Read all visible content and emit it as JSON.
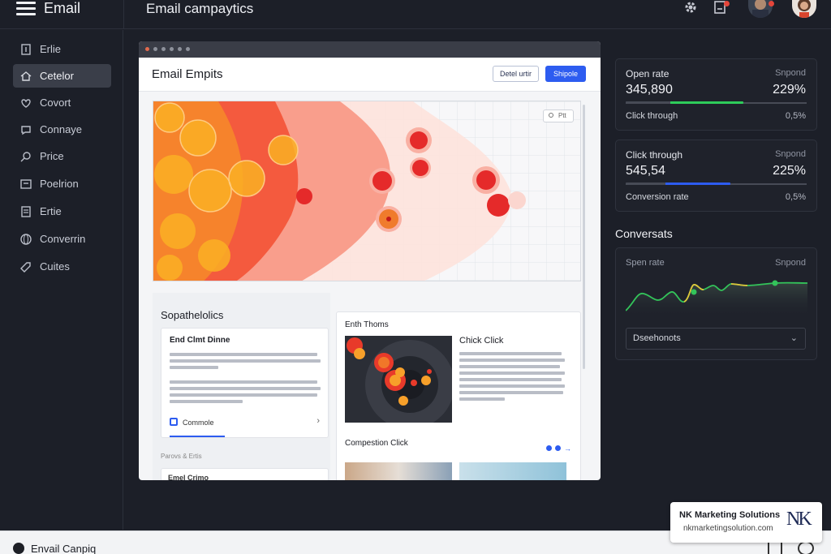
{
  "app": {
    "brand": "Email",
    "page_title": "Email campaytics"
  },
  "sidebar": {
    "items": [
      {
        "label": "Erlie",
        "icon": "file-icon"
      },
      {
        "label": "Cetelor",
        "icon": "home-icon",
        "active": true
      },
      {
        "label": "Covort",
        "icon": "heart-icon"
      },
      {
        "label": "Connaye",
        "icon": "chat-icon"
      },
      {
        "label": "Price",
        "icon": "search-icon"
      },
      {
        "label": "Poelrion",
        "icon": "image-icon"
      },
      {
        "label": "Ertie",
        "icon": "doc-icon"
      },
      {
        "label": "Converrin",
        "icon": "globe-icon"
      },
      {
        "label": "Cuites",
        "icon": "tag-icon"
      }
    ]
  },
  "preview": {
    "title": "Email Empits",
    "btn_secondary": "Detel urtir",
    "btn_primary": "Shipole",
    "heatmap_pill": "Ptt",
    "left_panel": {
      "title": "Sopathelolics",
      "card_title": "End Clmt Dinne",
      "card_button": "Commole",
      "sub_label": "Parovs & Ertis",
      "card2_title": "Emel Crimo"
    },
    "right_panel": {
      "title": "Enth Thoms",
      "heading": "Chick Click",
      "subtitle": "Compestion Click"
    }
  },
  "stats": [
    {
      "label": "Open rate",
      "right": "Snpond",
      "value": "345,890",
      "pct": "229%",
      "foot": "Click through",
      "foot_right": "0,5%",
      "bar_fill": 0.65,
      "bar_color": "#2ecc5a"
    },
    {
      "label": "Click through",
      "right": "Snpond",
      "value": "545,54",
      "pct": "225%",
      "foot": "Conversion rate",
      "foot_right": "0,5%",
      "bar_fill": 0.58,
      "bar_color": "#2d5cf0"
    }
  ],
  "conversions": {
    "title": "Conversats",
    "label": "Spen rate",
    "right": "Snpond",
    "select_value": "Dseehonots"
  },
  "bottombar": {
    "label": "Envail Canpiq"
  },
  "watermark": {
    "company": "NK Marketing Solutions",
    "url": "nkmarketingsolution.com",
    "logo": "NK"
  }
}
